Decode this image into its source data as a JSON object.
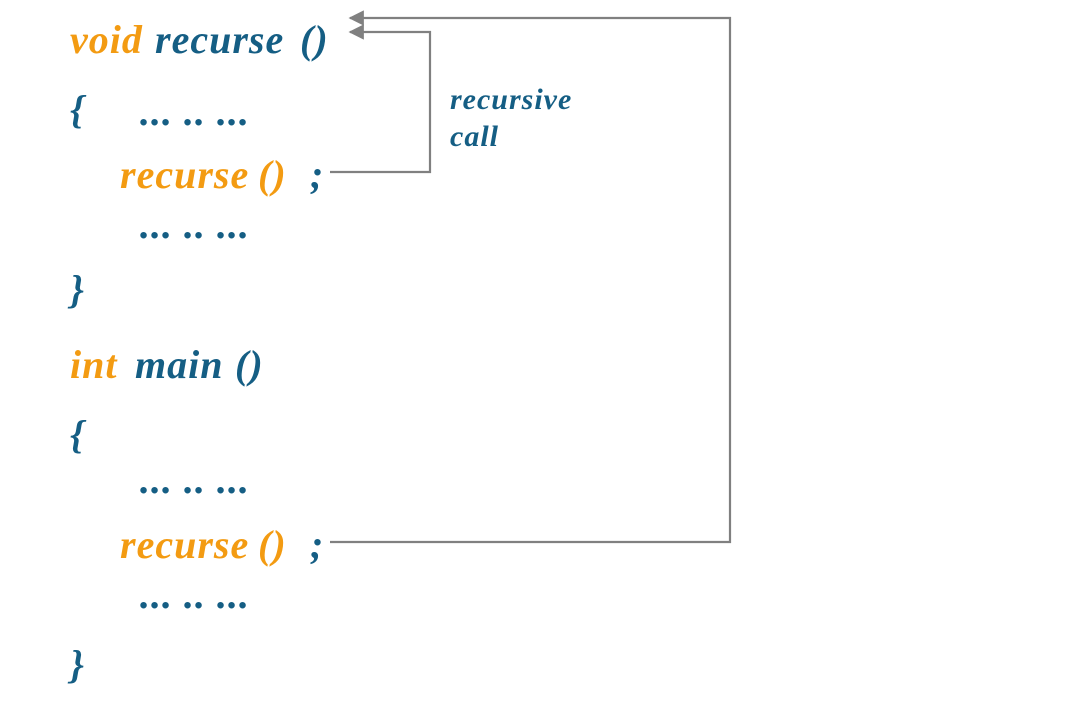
{
  "colors": {
    "blue": "#155e84",
    "orange": "#f39b12",
    "arrow": "#808080"
  },
  "func1": {
    "keyword": "void",
    "name": "recurse",
    "parens": "()",
    "open_brace": "{",
    "dots_before": "... .. ...",
    "call_name": "recurse",
    "call_parens": "()",
    "call_semi": ";",
    "dots_after": "... .. ...",
    "close_brace": "}"
  },
  "func2": {
    "keyword": "int",
    "name": "main",
    "parens": "()",
    "open_brace": "{",
    "dots_before": "... .. ...",
    "call_name": "recurse",
    "call_parens": "()",
    "call_semi": ";",
    "dots_after": "... .. ...",
    "close_brace": "}"
  },
  "annotation": {
    "line1": "recursive",
    "line2": "call"
  }
}
